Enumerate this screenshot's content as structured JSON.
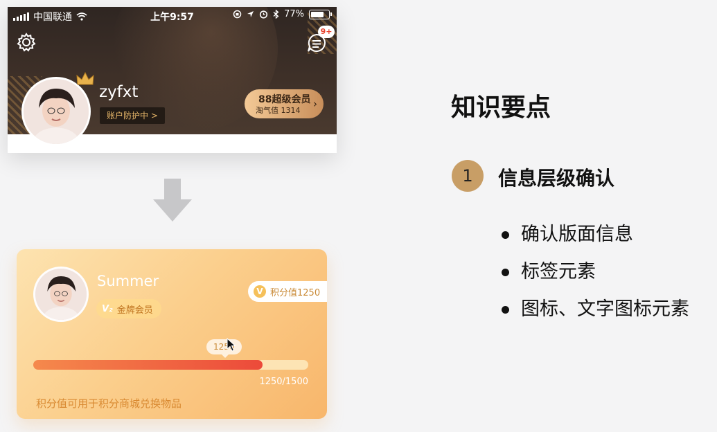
{
  "top_card": {
    "status_bar": {
      "carrier": "中国联通",
      "time": "上午9:57",
      "battery": "77%",
      "battery_level": 0.77
    },
    "message_badge": "9+",
    "username": "zyfxt",
    "account_link": "账户防护中 >",
    "vip": {
      "title": "88超级会员",
      "subtitle": "淘气值 1314"
    }
  },
  "member_card": {
    "name": "Summer",
    "level_icon": "V₂",
    "level_label": "金牌会员",
    "points_icon": "V",
    "points_label": "积分值1250",
    "tooltip": "1250",
    "progress_current": 1250,
    "progress_max": 1500,
    "progress_label": "1250/1500",
    "footer_note": "积分值可用于积分商城兑换物品"
  },
  "notes": {
    "heading": "知识要点",
    "section_number": "1",
    "section_title": "信息层级确认",
    "bullets": [
      "确认版面信息",
      "标签元素",
      "图标、文字图标元素"
    ]
  },
  "icons": {
    "status": [
      "signal-icon",
      "wifi-icon",
      "lock-rotation-icon",
      "location-icon",
      "alarm-icon",
      "bluetooth-icon",
      "battery-icon"
    ],
    "header": [
      "gear-icon",
      "message-icon",
      "crown-icon",
      "chevron-right-icon"
    ],
    "flow": [
      "down-arrow-icon",
      "cursor-icon"
    ]
  },
  "colors": {
    "header_dark": "#3e3028",
    "gold_accent": "#c89e66",
    "card_orange": "#fbcf8d",
    "progress_red": "#ec4a3a"
  }
}
